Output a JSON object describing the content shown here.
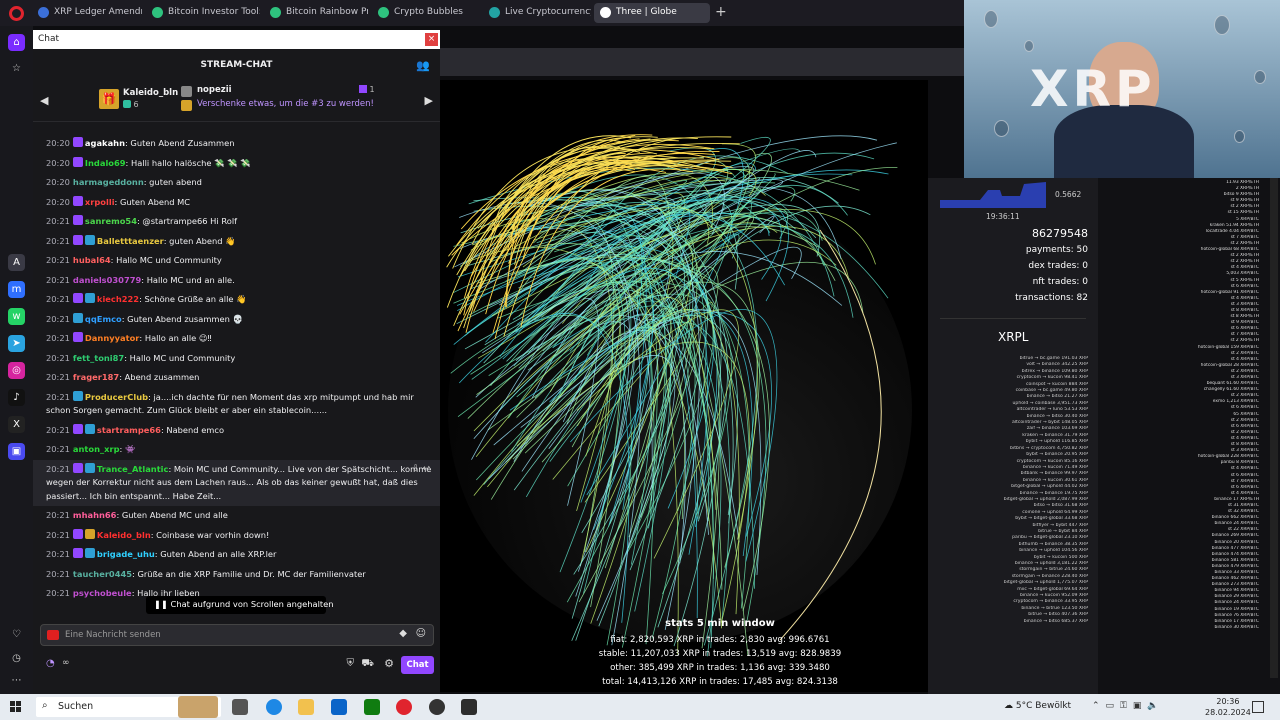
{
  "browser": {
    "tabs": [
      {
        "label": "XRP Ledger Amendments",
        "color": "#3b6fd8"
      },
      {
        "label": "Bitcoin Investor Tool: 2-Ye",
        "color": "#2ec27e"
      },
      {
        "label": "Bitcoin Rainbow Price Cha",
        "color": "#2ec27e"
      },
      {
        "label": "Crypto Bubbles",
        "color": "#2ec27e"
      },
      {
        "label": "Live Cryptocurrency Price",
        "color": "#22a3a3"
      },
      {
        "label": "Three | Globe",
        "color": "#ffffff"
      }
    ],
    "new_tab": "+"
  },
  "chat": {
    "window_title": "Chat",
    "close": "×",
    "header": "STREAM-CHAT",
    "gifts": {
      "leader1_name": "Kaleido_bln",
      "leader1_count": "6",
      "leader2_name": "nopezii",
      "leader2_count": "1",
      "cta": "Verschenke etwas, um die #3 zu werden!"
    },
    "messages": [
      {
        "time": "20:20",
        "badges": [
          "star"
        ],
        "user": "agakahn",
        "color": "#ffffff",
        "text": ": Guten Abend Zusammen"
      },
      {
        "time": "20:20",
        "badges": [
          "star"
        ],
        "user": "Indalo69",
        "color": "#29d93a",
        "text": ": Halli hallo halösche 💸 💸 💸"
      },
      {
        "time": "20:20",
        "badges": [],
        "user": "harmageddonn",
        "color": "#58b0a0",
        "text": ": guten abend"
      },
      {
        "time": "20:20",
        "badges": [
          "star"
        ],
        "user": "xrpolli",
        "color": "#ff4040",
        "text": ": Guten Abend MC"
      },
      {
        "time": "20:21",
        "badges": [
          "star"
        ],
        "user": "sanremo54",
        "color": "#4cd64c",
        "text": ": @startrampe66 Hi Rolf"
      },
      {
        "time": "20:21",
        "badges": [
          "star",
          "sub"
        ],
        "user": "Balletttaenzer",
        "color": "#e8c840",
        "text": ": guten Abend 👋"
      },
      {
        "time": "20:21",
        "badges": [],
        "user": "hubal64",
        "color": "#ff6060",
        "text": ": Hallo MC und Community"
      },
      {
        "time": "20:21",
        "badges": [],
        "user": "daniels030779",
        "color": "#c050d0",
        "text": ": Hallo MC und an alle."
      },
      {
        "time": "20:21",
        "badges": [
          "star",
          "sub"
        ],
        "user": "kiech222",
        "color": "#ff3030",
        "text": ": Schöne Grüße an alle 👋"
      },
      {
        "time": "20:21",
        "badges": [
          "sub"
        ],
        "user": "qqEmco",
        "color": "#2f9fff",
        "text": ": Guten Abend zusammen 💀"
      },
      {
        "time": "20:21",
        "badges": [
          "star"
        ],
        "user": "Dannyyator",
        "color": "#ff7f24",
        "text": ": Hallo an alle 😉‼"
      },
      {
        "time": "20:21",
        "badges": [],
        "user": "fett_toni87",
        "color": "#2ecc71",
        "text": ": Hallo MC und Community"
      },
      {
        "time": "20:21",
        "badges": [],
        "user": "frager187",
        "color": "#ff6a6a",
        "text": ": Abend zusammen"
      },
      {
        "time": "20:21",
        "badges": [
          "sub"
        ],
        "user": "ProducerClub",
        "color": "#e8c840",
        "text": ": ja....ich dachte für nen Moment das xrp mitpumpt und hab mir schon Sorgen gemacht. Zum Glück bleibt er aber ein stablecoin......"
      },
      {
        "time": "20:21",
        "badges": [
          "star",
          "sub"
        ],
        "user": "startrampe66",
        "color": "#ff5e5e",
        "text": ": Nabend emco"
      },
      {
        "time": "20:21",
        "badges": [],
        "user": "anton_xrp",
        "color": "#29d93a",
        "text": ": 👾"
      },
      {
        "time": "20:21",
        "badges": [
          "star",
          "sub"
        ],
        "user": "Trance_Atlantic",
        "color": "#29d93a",
        "text": ": Moin MC und Community... Live von der Spätschicht... komme wegen der Korrektur nicht aus dem Lachen raus... Als ob das keiner gewußt hat, daß dies passiert... Ich bin entspannt... Habe Zeit...",
        "highlight": true
      },
      {
        "time": "20:21",
        "badges": [],
        "user": "mhahn66",
        "color": "#ff5e9a",
        "text": ": Guten Abend MC und alle"
      },
      {
        "time": "20:21",
        "badges": [
          "star",
          "gift"
        ],
        "user": "Kaleido_bln",
        "color": "#ff3030",
        "text": ": Coinbase war vorhin down!"
      },
      {
        "time": "20:21",
        "badges": [
          "star",
          "sub"
        ],
        "user": "brigade_uhu",
        "color": "#2fd0ff",
        "text": ": Guten Abend an alle XRP.ler"
      },
      {
        "time": "20:21",
        "badges": [],
        "user": "taucher0445",
        "color": "#58b0a0",
        "text": ": Grüße an die XRP Familie und Dr. MC der Familienvater"
      },
      {
        "time": "20:21",
        "badges": [],
        "user": "psychobeule",
        "color": "#c050d0",
        "text": ": Hallo ihr lieben"
      }
    ],
    "paused_notice": "Chat aufgrund von Scrollen angehalten",
    "input_placeholder": "Eine Nachricht senden",
    "points": "∞",
    "send_label": "Chat"
  },
  "globe": {
    "stats_title": "stats 5 min window",
    "stats_lines": [
      "fiat: 2,820,593 XRP in trades: 2,830 avg: 996.6761",
      "stable: 11,207,033 XRP in trades: 13,519 avg: 828.9839",
      "other: 385,499 XRP in trades: 1,136 avg: 339.3480",
      "total: 14,413,126 XRP in trades: 17,485 avg: 824.3138"
    ]
  },
  "panel": {
    "mini_value": "0.5662",
    "mini_time": "19:36:11",
    "ledger": "86279548",
    "payments": "payments: 50",
    "dex_trades": "dex trades: 0",
    "nft_trades": "nft trades: 0",
    "transactions": "transactions: 82",
    "section_title": "XRPL",
    "trades": [
      "bitrue → bc.game 191.03 XRP",
      "volt → binance 342.25 XRP",
      "bitrex → binance 109.80 XRP",
      "cryptocom → kucoin 98.41 XRP",
      "coinspot → kucoin 884 XRP",
      "coinbase → bc.game 49.80 XRP",
      "binance → bitso 21.27 XRP",
      "uphold → coinbase 3,951.73 XRP",
      "altcointrader → luno 53.53 XRP",
      "binance → bitso 30.40 XRP",
      "altcointrader → bybit 148.05 XRP",
      "zaif → binance 103.69 XRP",
      "kraken → binance 31.79 XRP",
      "bybit → uphold 116.85 XRP",
      "bitbns → cryptocom 4,750.82 XRP",
      "bybit → binance 20.95 XRP",
      "cryptocom → kucoin 85.16 XRP",
      "binance → kucoin 71.49 XRP",
      "bitbank → binance 99.97 XRP",
      "binance → kucoin 30.61 XRP",
      "bitget-global → uphold 44.02 XRP",
      "binance → binance 19.75 XRP",
      "bitget-global → uphold 2,087.99 XRP",
      "bitso → bitso 31.68 XRP",
      "coinone → uphold 64.99 XRP",
      "bybit → bitget-global 33.68 XRP",
      "bitflyer → bybit 447 XRP",
      "bitrue → bybit 84 XRP",
      "paribu → bitget-global 23.10 XRP",
      "bithumb → binance 38.35 XRP",
      "binance → uphold 104.56 XRP",
      "bybit → kucoin 500 XRP",
      "binance → uphold 3,181.22 XRP",
      "stormgain → bitrue 24.60 XRP",
      "stormgain → binance 228.40 XRP",
      "bitget-global → uphold 1,775.07 XRP",
      "mxc → bitget-global 69.64 XRP",
      "binance → kucoin 952.09 XRP",
      "cryptocom → binance 33.95 XRP",
      "binance → bitrue 123.50 XRP",
      "bitrue → bitso 407.36 XRP",
      "binance → bitso 685.37 XRP"
    ],
    "dex": [
      "11.93 XRP/ETH",
      "2 XRP/ETH",
      "bitso 9 XRP/ETH",
      "st 9 XRP/ETH",
      "st 2 XRP/ETH",
      "st 15 XRP/ETH",
      "5 XRP/BTC",
      "kraken 51.94 XRP/ETH",
      "localtrade 4.04 XRP/BTC",
      "st 7 XRP/BTC",
      "st 2 XRP/ETH",
      "hotcoin-global 68 XRP/BTC",
      "st 2 XRP/ETH",
      "st 2 XRP/ETH",
      "st 4 XRP/BTC",
      "5,003 XRP/BTC",
      "st 5 XRP/ETH",
      "st 6 XRP/BTC",
      "hotcoin-global 91 XRP/BTC",
      "st 4 XRP/BTC",
      "st 3 XRP/BTC",
      "st 8 XRP/BTC",
      "st 8 XRP/ETH",
      "st 9 XRP/BTC",
      "st 6 XRP/BTC",
      "st 7 XRP/BTC",
      "st 2 XRP/ETH",
      "hotcoin-global 159 XRP/BTC",
      "st 2 XRP/BTC",
      "st 4 XRP/BTC",
      "hotcoin-global 28 XRP/BTC",
      "st 2 XRP/BTC",
      "st 3 XRP/BTC",
      "bequant 61.60 XRP/BTC",
      "changelly 61.60 XRP/BTC",
      "st 2 XRP/BTC",
      "exmo 1,213 XRP/BTC",
      "st 6 XRP/BTC",
      "65 XRP/BTC",
      "st 2 XRP/BTC",
      "st 6 XRP/BTC",
      "st 2 XRP/BTC",
      "st 4 XRP/BTC",
      "st 8 XRP/BTC",
      "st 3 XRP/BTC",
      "hotcoin-global 228 XRP/BTC",
      "paribu 8 XRP/BTC",
      "st 4 XRP/BTC",
      "st 6 XRP/BTC",
      "st 7 XRP/BTC",
      "st 6 XRP/BTC",
      "st 4 XRP/BTC",
      "binance 17 XRP/ETH",
      "st 31 XRP/BTC",
      "st 32 XRP/BTC",
      "binance 662 XRP/BTC",
      "binance 24 XRP/BTC",
      "st 22 XRP/BTC",
      "binance 269 XRP/BTC",
      "binance 20 XRP/BTC",
      "binance 477 XRP/BTC",
      "binance 474 XRP/BTC",
      "binance 581 XRP/BTC",
      "binance 479 XRP/BTC",
      "binance 33 XRP/BTC",
      "binance 462 XRP/BTC",
      "binance 273 XRP/BTC",
      "binance 94 XRP/BTC",
      "binance 29 XRP/BTC",
      "binance 24 XRP/BTC",
      "binance 19 XRP/BTC",
      "binance 76 XRP/BTC",
      "binance 17 XRP/BTC",
      "binance 30 XRP/BTC"
    ]
  },
  "webcam": {
    "logo_text": "XRP"
  },
  "taskbar": {
    "search_label": "Suchen",
    "weather": "5°C  Bewölkt",
    "time": "20:36",
    "date": "28.02.2024"
  }
}
